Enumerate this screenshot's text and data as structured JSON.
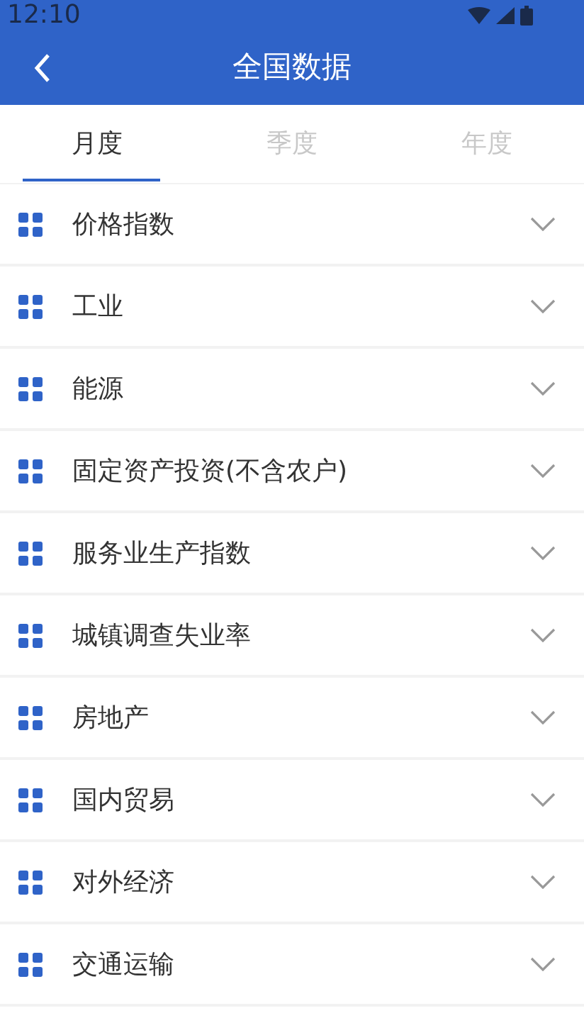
{
  "status_bar": {
    "time": "12:10"
  },
  "app_bar": {
    "title": "全国数据"
  },
  "tabs": [
    {
      "label": "月度",
      "selected": true
    },
    {
      "label": "季度",
      "selected": false
    },
    {
      "label": "年度",
      "selected": false
    }
  ],
  "categories": [
    {
      "label": "价格指数",
      "expanded": false
    },
    {
      "label": "工业",
      "expanded": false
    },
    {
      "label": "能源",
      "expanded": false
    },
    {
      "label": "固定资产投资(不含农户)",
      "expanded": false
    },
    {
      "label": "服务业生产指数",
      "expanded": false
    },
    {
      "label": "城镇调查失业率",
      "expanded": false
    },
    {
      "label": "房地产",
      "expanded": false
    },
    {
      "label": "国内贸易",
      "expanded": false
    },
    {
      "label": "对外经济",
      "expanded": false
    },
    {
      "label": "交通运输",
      "expanded": false
    }
  ]
}
